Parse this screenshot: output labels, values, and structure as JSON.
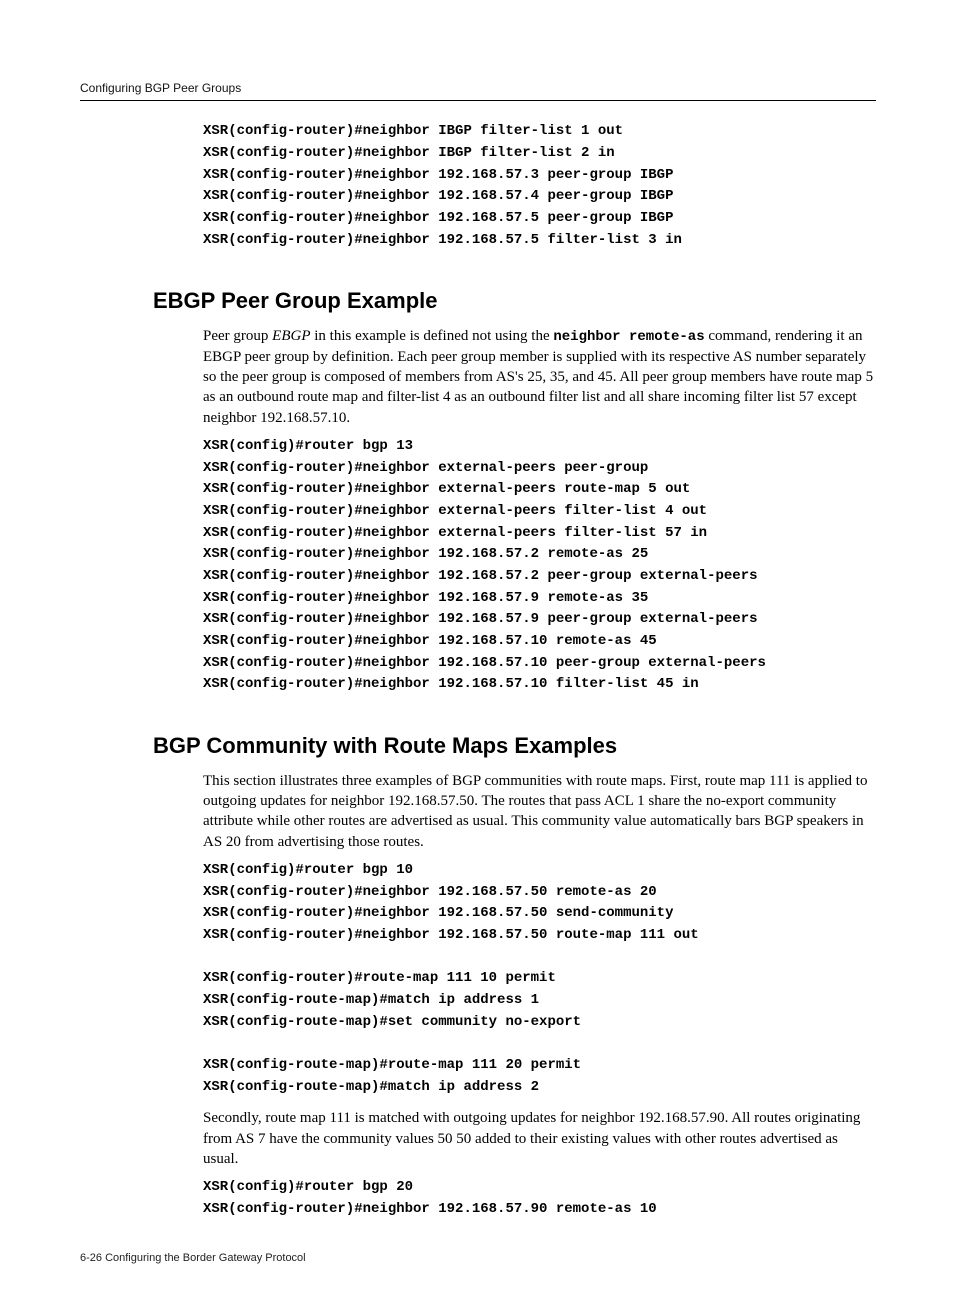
{
  "header": {
    "title": "Configuring BGP Peer Groups"
  },
  "blocks": {
    "code1": "XSR(config-router)#neighbor IBGP filter-list 1 out\nXSR(config-router)#neighbor IBGP filter-list 2 in\nXSR(config-router)#neighbor 192.168.57.3 peer-group IBGP\nXSR(config-router)#neighbor 192.168.57.4 peer-group IBGP\nXSR(config-router)#neighbor 192.168.57.5 peer-group IBGP\nXSR(config-router)#neighbor 192.168.57.5 filter-list 3 in"
  },
  "sections": {
    "s1": {
      "title": "EBGP Peer Group Example",
      "para_lead": "Peer group ",
      "para_em": "EBGP",
      "para_mid1": " in this example is defined not using the ",
      "para_mono": "neighbor remote-as",
      "para_tail": " command, rendering it an EBGP peer group by definition. Each peer group member is supplied with its respective AS number separately so the peer group is composed of members from AS's 25, 35, and 45. All peer group members have route map 5 as an outbound route map and filter-list 4 as an outbound filter list and all share incoming filter list 57 except neighbor 192.168.57.10.",
      "code": "XSR(config)#router bgp 13\nXSR(config-router)#neighbor external-peers peer-group\nXSR(config-router)#neighbor external-peers route-map 5 out\nXSR(config-router)#neighbor external-peers filter-list 4 out\nXSR(config-router)#neighbor external-peers filter-list 57 in\nXSR(config-router)#neighbor 192.168.57.2 remote-as 25\nXSR(config-router)#neighbor 192.168.57.2 peer-group external-peers\nXSR(config-router)#neighbor 192.168.57.9 remote-as 35\nXSR(config-router)#neighbor 192.168.57.9 peer-group external-peers\nXSR(config-router)#neighbor 192.168.57.10 remote-as 45\nXSR(config-router)#neighbor 192.168.57.10 peer-group external-peers\nXSR(config-router)#neighbor 192.168.57.10 filter-list 45 in"
    },
    "s2": {
      "title": "BGP Community with Route Maps Examples",
      "para1": "This section illustrates three examples of BGP communities with route maps. First, route map 111 is applied to outgoing updates for neighbor 192.168.57.50. The routes that pass ACL 1 share the no-export community attribute while other routes are advertised as usual. This community value automatically bars BGP speakers in AS 20 from advertising those routes.",
      "code1": "XSR(config)#router bgp 10\nXSR(config-router)#neighbor 192.168.57.50 remote-as 20\nXSR(config-router)#neighbor 192.168.57.50 send-community\nXSR(config-router)#neighbor 192.168.57.50 route-map 111 out\n\nXSR(config-router)#route-map 111 10 permit\nXSR(config-route-map)#match ip address 1\nXSR(config-route-map)#set community no-export\n\nXSR(config-route-map)#route-map 111 20 permit\nXSR(config-route-map)#match ip address 2",
      "para2": "Secondly, route map 111 is matched with outgoing updates for neighbor 192.168.57.90. All routes originating from AS 7 have the community values 50 50 added to their existing values with other routes advertised as usual.",
      "code2": "XSR(config)#router bgp 20\nXSR(config-router)#neighbor 192.168.57.90 remote-as 10"
    }
  },
  "footer": {
    "left": "6-26   Configuring the Border Gateway Protocol"
  }
}
